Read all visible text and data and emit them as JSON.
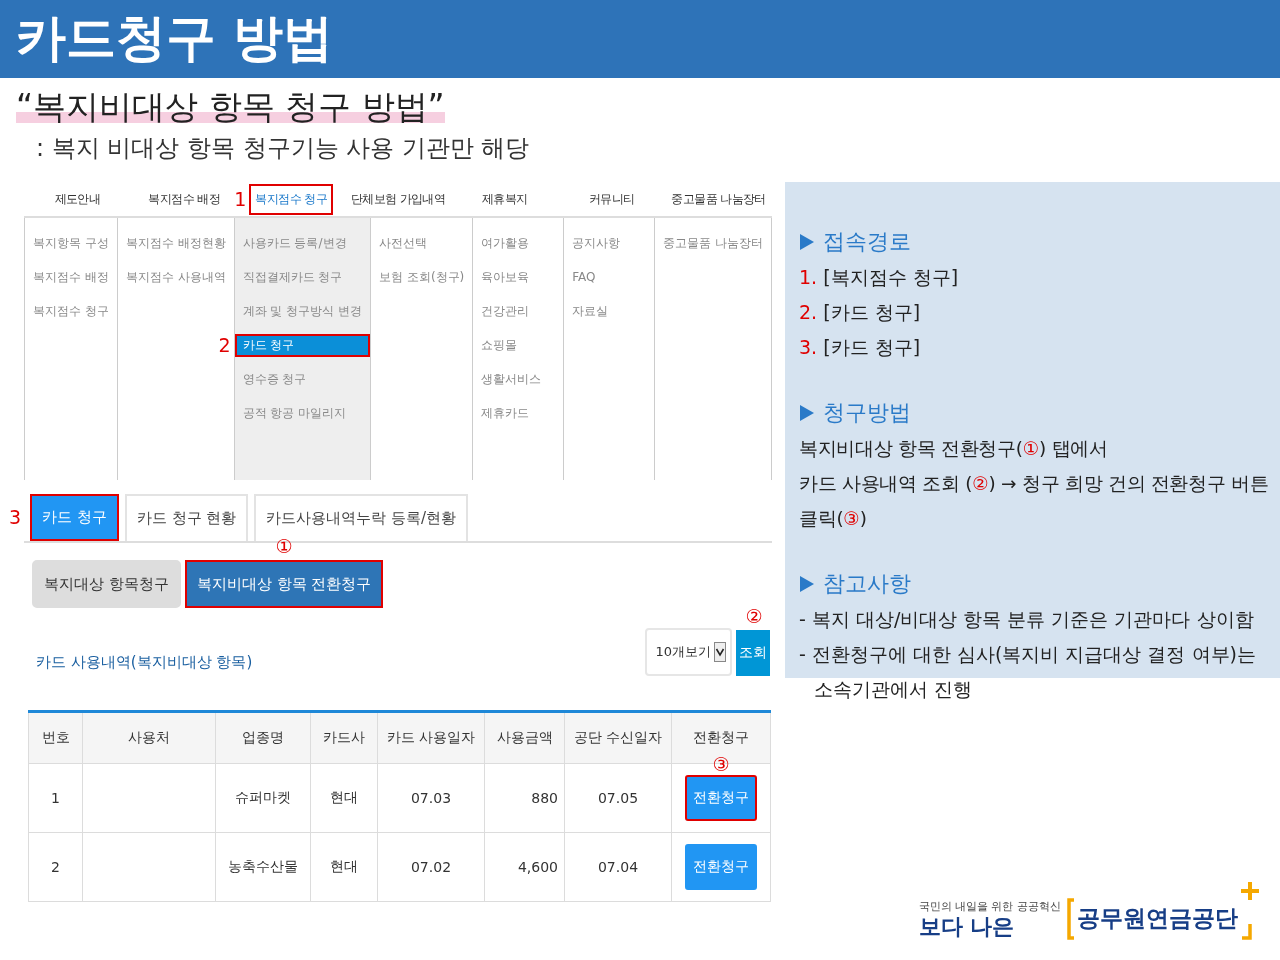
{
  "header": {
    "title": "카드청구 방법"
  },
  "intro": {
    "heading": "“복지비대상 항목 청구 방법”",
    "note": ": 복지 비대상 항목 청구기능 사용 기관만 해당"
  },
  "menu": {
    "columns": [
      {
        "label": "제도안내",
        "selected": false,
        "items": [
          {
            "label": "복지항목 구성",
            "selected": false
          },
          {
            "label": "복지점수 배정",
            "selected": false
          },
          {
            "label": "복지점수 청구",
            "selected": false
          }
        ]
      },
      {
        "label": "복지점수 배정",
        "selected": false,
        "items": [
          {
            "label": "복지점수 배정현황",
            "selected": false
          },
          {
            "label": "복지점수 사용내역",
            "selected": false
          }
        ]
      },
      {
        "label": "복지점수 청구",
        "selected": true,
        "highlighted": true,
        "step": "1",
        "items": [
          {
            "label": "사용카드 등록/변경",
            "selected": false
          },
          {
            "label": "직접결제카드 청구",
            "selected": false
          },
          {
            "label": "계좌 및 청구방식 변경",
            "selected": false
          },
          {
            "label": "카드 청구",
            "selected": true,
            "highlighted": true,
            "step": "2"
          },
          {
            "label": "영수증 청구",
            "selected": false
          },
          {
            "label": "공적 항공 마일리지",
            "selected": false
          }
        ]
      },
      {
        "label": "단체보험 가입내역",
        "selected": false,
        "items": [
          {
            "label": "사전선택",
            "selected": false
          },
          {
            "label": "보험 조회(청구)",
            "selected": false
          }
        ]
      },
      {
        "label": "제휴복지",
        "selected": false,
        "items": [
          {
            "label": "여가활용",
            "selected": false
          },
          {
            "label": "육아보육",
            "selected": false
          },
          {
            "label": "건강관리",
            "selected": false
          },
          {
            "label": "쇼핑몰",
            "selected": false
          },
          {
            "label": "생활서비스",
            "selected": false
          },
          {
            "label": "제휴카드",
            "selected": false
          }
        ]
      },
      {
        "label": "커뮤니티",
        "selected": false,
        "items": [
          {
            "label": "공지사항",
            "selected": false
          },
          {
            "label": "FAQ",
            "selected": false
          },
          {
            "label": "자료실",
            "selected": false
          }
        ]
      },
      {
        "label": "중고물품 나눔장터",
        "selected": false,
        "items": [
          {
            "label": "중고물품 나눔장터",
            "selected": false
          }
        ]
      }
    ]
  },
  "tabs": [
    {
      "label": "카드 청구",
      "selected": true,
      "highlighted": true,
      "step": "3"
    },
    {
      "label": "카드 청구 현황",
      "selected": false
    },
    {
      "label": "카드사용내역누락 등록/현황",
      "selected": false
    }
  ],
  "subtabs": [
    {
      "label": "복지대상 항목청구",
      "selected": false
    },
    {
      "label": "복지비대상 항목 전환청구",
      "selected": true,
      "highlighted": true,
      "step": "①"
    }
  ],
  "list": {
    "title": "카드 사용내역(복지비대상 항목)",
    "page_size": "10개보기",
    "search_button": {
      "label": "조회",
      "step": "②"
    }
  },
  "table": {
    "columns": [
      {
        "label": "번호"
      },
      {
        "label": "사용처"
      },
      {
        "label": "업종명"
      },
      {
        "label": "카드사"
      },
      {
        "label": "카드 사용일자"
      },
      {
        "label": "사용금액"
      },
      {
        "label": "공단 수신일자"
      },
      {
        "label": "전환청구"
      }
    ],
    "rows": [
      {
        "number": "1",
        "industry": "슈퍼마켓",
        "card_company": "현대",
        "use_date": "07.03",
        "amount": "880",
        "received_date": "07.05",
        "action": {
          "label": "전환청구",
          "highlighted": true,
          "step": "③"
        }
      },
      {
        "number": "2",
        "industry": "농축수산물",
        "card_company": "현대",
        "use_date": "07.02",
        "amount": "4,600",
        "received_date": "07.04",
        "action": {
          "label": "전환청구",
          "highlighted": false
        }
      }
    ]
  },
  "guide": {
    "sections": [
      {
        "heading": "접속경로",
        "kind": "numbered",
        "lines": [
          {
            "number": "1.",
            "text": "[복지점수 청구]"
          },
          {
            "number": "2.",
            "text": "[카드 청구]"
          },
          {
            "number": "3.",
            "text": "[카드 청구]"
          }
        ]
      },
      {
        "heading": "청구방법",
        "kind": "paragraph",
        "paragraphs": [
          [
            {
              "text": "복지비대상 항목 전환청구("
            },
            {
              "text": "①",
              "accent": true
            },
            {
              "text": ") 탭에서"
            }
          ],
          [
            {
              "text": "카드 사용내역 조회 ("
            },
            {
              "text": "②",
              "accent": true
            },
            {
              "text": ") → 청구 희망 건의 전환청구 버튼 클릭("
            },
            {
              "text": "③",
              "accent": true
            },
            {
              "text": ")"
            }
          ]
        ]
      },
      {
        "heading": "참고사항",
        "kind": "bullets",
        "lines": [
          "- 복지 대상/비대상 항목 분류 기준은 기관마다 상이함",
          "- 전환청구에 대한 심사(복지비 지급대상 결정 여부)는 소속기관에서 진행"
        ]
      }
    ]
  },
  "logo": {
    "tagline": "국민의 내일을 위한 공공혁신",
    "slogan": "보다 나은",
    "name": "공무원연금공단"
  }
}
